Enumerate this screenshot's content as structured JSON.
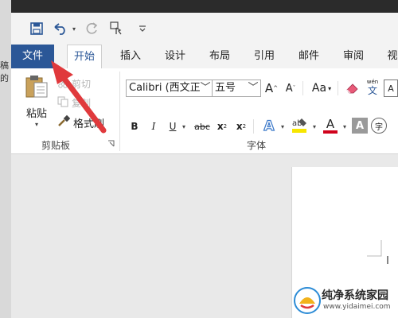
{
  "left_edge_text": "稿的",
  "tabs": [
    "文件",
    "开始",
    "插入",
    "设计",
    "布局",
    "引用",
    "邮件",
    "审阅",
    "视"
  ],
  "clipboard": {
    "paste": "粘贴",
    "cut": "剪切",
    "copy": "复制",
    "format_painter": "格式刷",
    "group_label": "剪贴板"
  },
  "font": {
    "font_name": "Calibri (西文正",
    "font_size": "五号",
    "grow": "A",
    "shrink": "A",
    "change_case": "Aa",
    "phonetic_top": "wén",
    "phonetic_bottom": "文",
    "bold": "B",
    "italic": "I",
    "underline": "U",
    "strikethrough": "abc",
    "subscript": "x",
    "superscript": "x",
    "text_effects": "A",
    "font_color": "A",
    "char_shading": "A",
    "enclose": "字",
    "group_label": "字体"
  },
  "watermark": {
    "title": "纯净系统家园",
    "url": "www.yidaimei.com"
  },
  "colors": {
    "file_tab": "#2b5797",
    "arrow": "#e0393c",
    "highlight": "#f7e600",
    "font_red": "#d0021b"
  }
}
